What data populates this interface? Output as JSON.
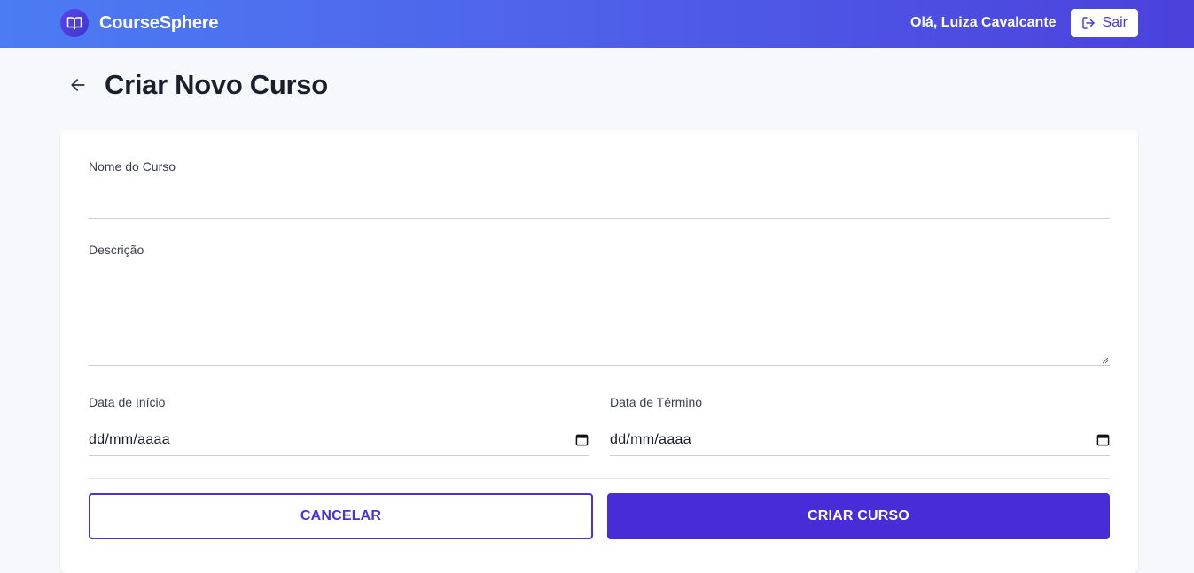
{
  "header": {
    "brand_name": "CourseSphere",
    "greeting": "Olá, Luiza Cavalcante",
    "logout_label": "Sair"
  },
  "page": {
    "title": "Criar Novo Curso"
  },
  "form": {
    "name": {
      "label": "Nome do Curso",
      "value": ""
    },
    "description": {
      "label": "Descrição",
      "value": ""
    },
    "start_date": {
      "label": "Data de Início",
      "value": "dd/mm/aaaa"
    },
    "end_date": {
      "label": "Data de Término",
      "value": "dd/mm/aaaa"
    },
    "cancel_label": "CANCELAR",
    "submit_label": "CRIAR CURSO"
  },
  "icons": {
    "brand": "book-open-icon",
    "logout": "logout-icon",
    "back": "arrow-left-icon",
    "calendar": "calendar-icon"
  },
  "colors": {
    "header_gradient_start": "#4b7cf3",
    "header_gradient_end": "#4b41dc",
    "accent": "#472cd7",
    "background": "#f7f8fb"
  }
}
